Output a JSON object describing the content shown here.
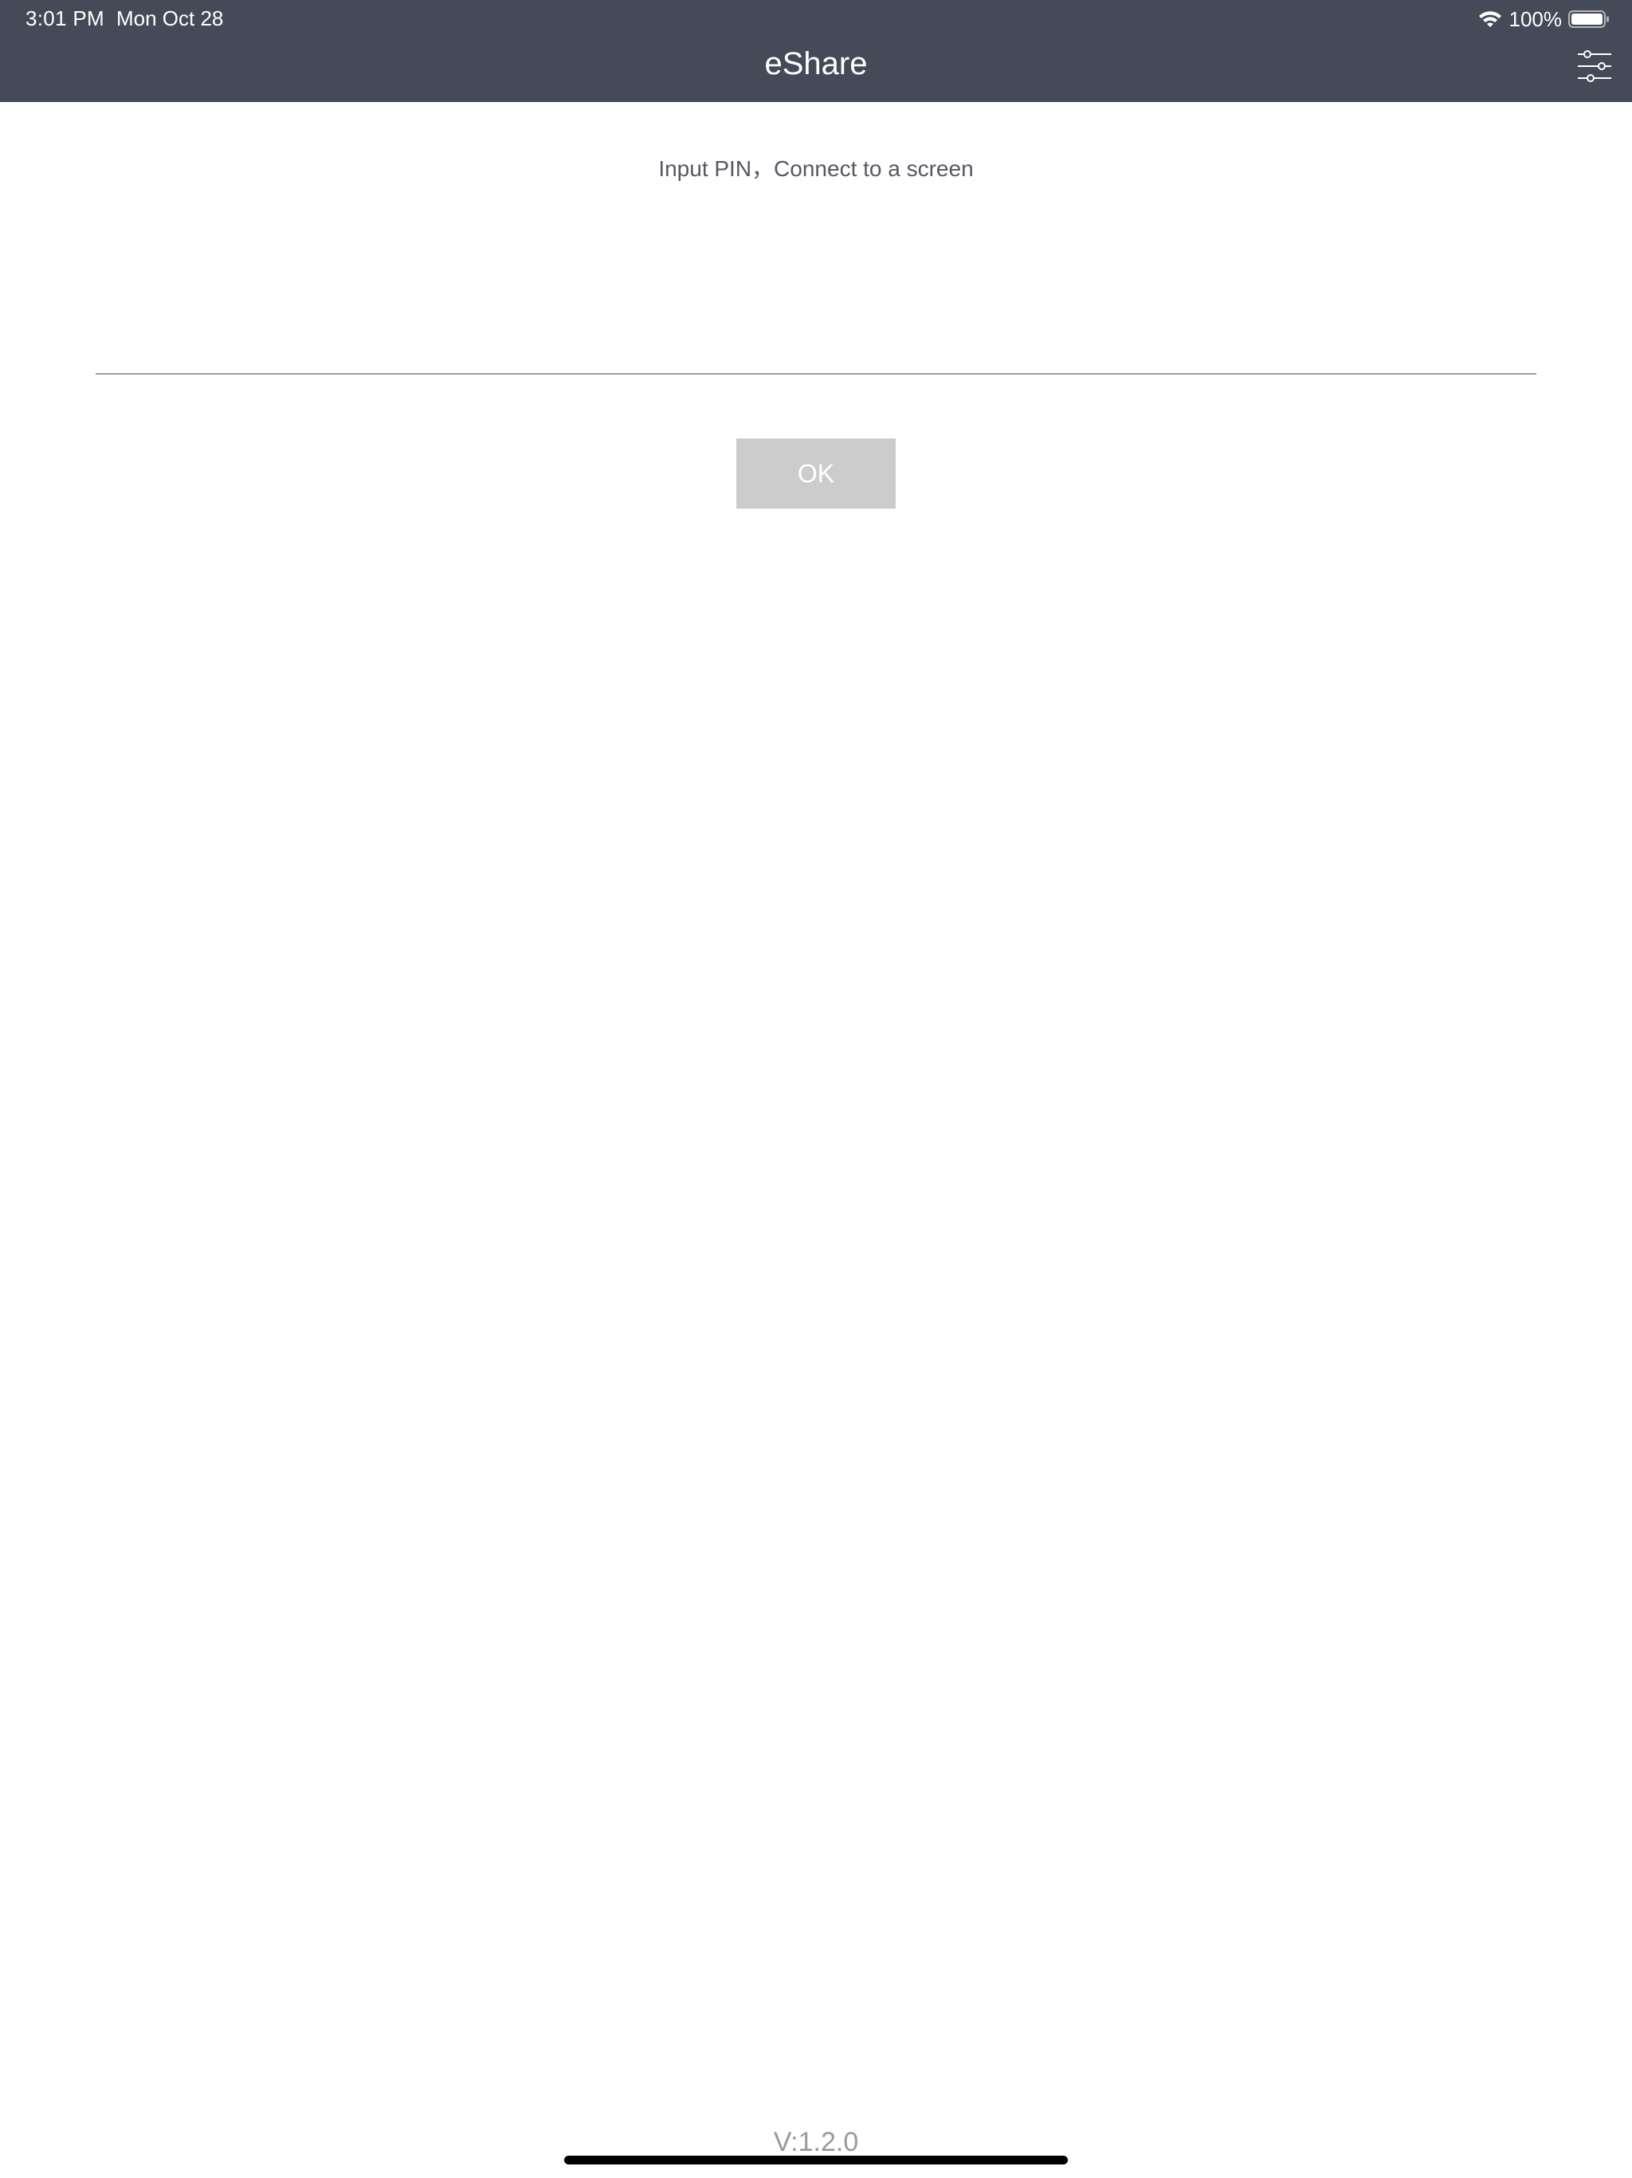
{
  "status_bar": {
    "time": "3:01 PM",
    "date": "Mon Oct 28",
    "battery_percent": "100%",
    "wifi_icon": "wifi-icon",
    "battery_icon": "battery-icon"
  },
  "header": {
    "title": "eShare",
    "settings_icon": "sliders-icon",
    "background_color": "#454a58"
  },
  "main": {
    "instruction": "Input PIN，Connect to a screen",
    "pin_input_value": "",
    "pin_input_placeholder": "",
    "ok_label": "OK",
    "ok_button_color": "#cccccc"
  },
  "footer": {
    "version": "V:1.2.0"
  }
}
